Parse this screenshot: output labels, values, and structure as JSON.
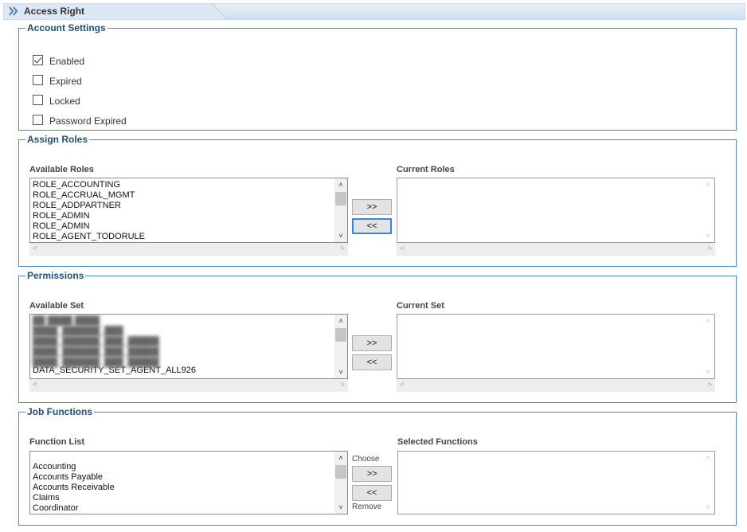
{
  "header": {
    "title": "Access Right",
    "icon": "double-chevron-right-icon"
  },
  "account_settings": {
    "legend": "Account Settings",
    "checkboxes": [
      {
        "label": "Enabled",
        "checked": true
      },
      {
        "label": "Expired",
        "checked": false
      },
      {
        "label": "Locked",
        "checked": false
      },
      {
        "label": "Password Expired",
        "checked": false
      }
    ]
  },
  "assign_roles": {
    "legend": "Assign Roles",
    "available_label": "Available Roles",
    "current_label": "Current Roles",
    "available_items": [
      "ROLE_ACCOUNTING",
      "ROLE_ACCRUAL_MGMT",
      "ROLE_ADDPARTNER",
      "ROLE_ADMIN",
      "ROLE_ADMIN",
      "ROLE_AGENT_TODORULE"
    ],
    "add_label": ">>",
    "remove_label": "<<"
  },
  "permissions": {
    "legend": "Permissions",
    "available_label": "Available Set",
    "current_label": "Current Set",
    "available_items": [
      "██ ████ ████",
      "████_██████_███",
      "████_██████_███_█████",
      "████_██████_███_█████",
      "████_██████_███_█████",
      "DATA_SECURITY_SET_AGENT_ALL926"
    ],
    "add_label": ">>",
    "remove_label": "<<"
  },
  "job_functions": {
    "legend": "Job Functions",
    "available_label": "Function List",
    "current_label": "Selected Functions",
    "available_items": [
      "Accounting",
      "Accounts Payable",
      "Accounts Receivable",
      "Claims",
      "Coordinator"
    ],
    "choose_label": "Choose",
    "remove_text": "Remove",
    "add_label": ">>",
    "remove_label": "<<"
  },
  "scroll_glyphs": {
    "up": "˄",
    "down": "˅",
    "left": "<",
    "right": ">"
  }
}
